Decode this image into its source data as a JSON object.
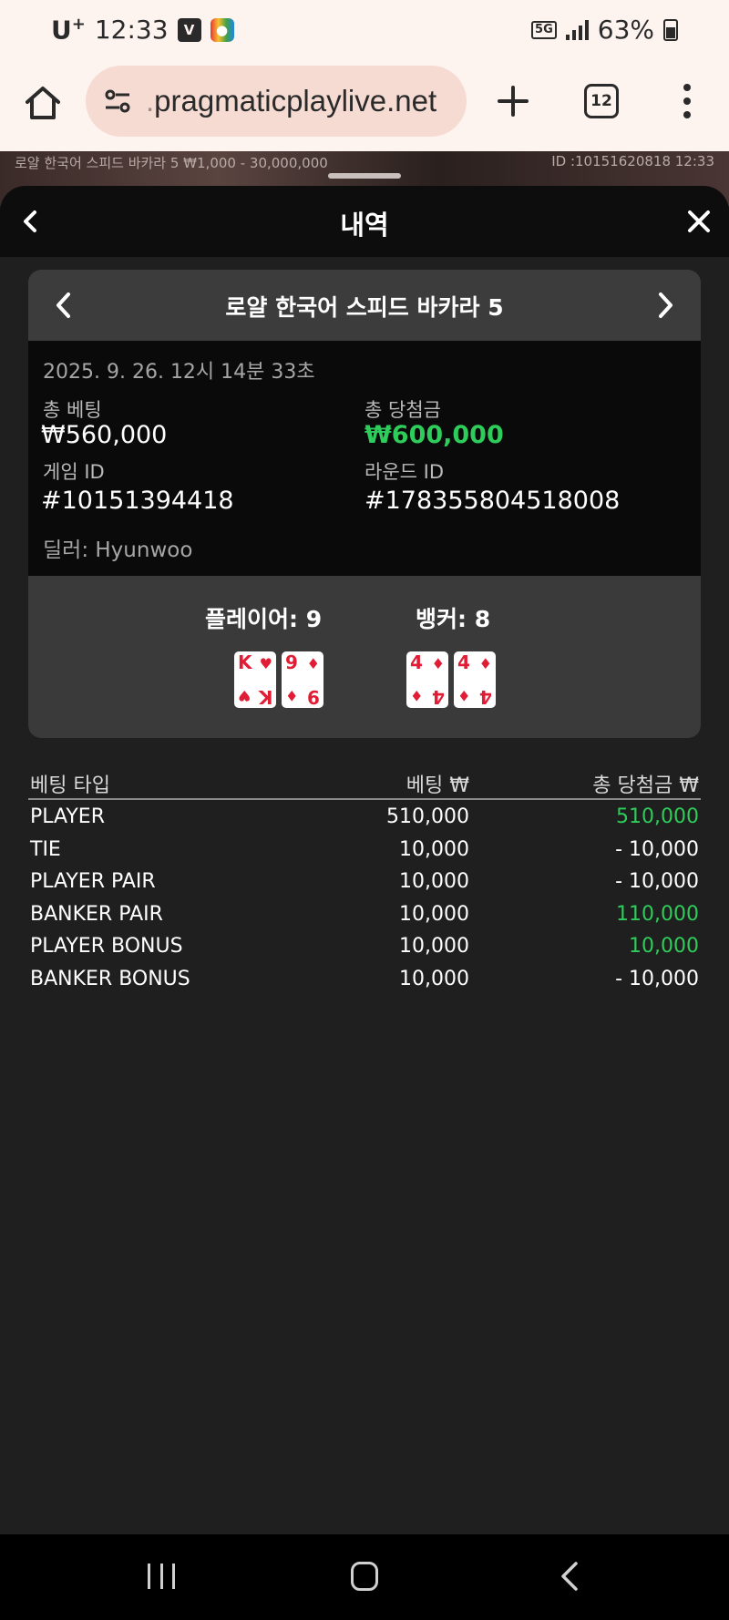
{
  "status_bar": {
    "carrier": "U",
    "carrier_sup": "+",
    "time": "12:33",
    "icon_v": "V",
    "icon_map": "map-icon",
    "network": "5G",
    "battery": "63%"
  },
  "browser": {
    "url_prefix": ".",
    "url": "pragmaticplaylive.net",
    "tab_count": "12"
  },
  "game_strip": {
    "table_info": "로얄 한국어 스피드 바카라 5 ₩1,000 - 30,000,000",
    "id_info": "ID :10151620818 12:33"
  },
  "sheet": {
    "title": "내역"
  },
  "round": {
    "game_name": "로얄 한국어 스피드 바카라 5",
    "datetime": "2025. 9. 26. 12시 14분 33초",
    "total_bet_label": "총 베팅",
    "total_bet": "₩560,000",
    "total_win_label": "총 당첨금",
    "total_win": "₩600,000",
    "game_id_label": "게임 ID",
    "game_id": "#10151394418",
    "round_id_label": "라운드 ID",
    "round_id": "#178355804518008",
    "dealer": "딜러: Hyunwoo",
    "player_label": "플레이어: 9",
    "banker_label": "뱅커: 8",
    "player_cards": [
      {
        "rank": "K",
        "suit": "♥"
      },
      {
        "rank": "9",
        "suit": "♦"
      }
    ],
    "banker_cards": [
      {
        "rank": "4",
        "suit": "♦"
      },
      {
        "rank": "4",
        "suit": "♦"
      }
    ]
  },
  "bets": {
    "headers": {
      "type": "베팅 타입",
      "bet": "베팅 ₩",
      "win": "총 당첨금 ₩"
    },
    "rows": [
      {
        "type": "PLAYER",
        "bet": "510,000",
        "win": "510,000",
        "positive": true
      },
      {
        "type": "TIE",
        "bet": "10,000",
        "win": "- 10,000",
        "positive": false
      },
      {
        "type": "PLAYER PAIR",
        "bet": "10,000",
        "win": "- 10,000",
        "positive": false
      },
      {
        "type": "BANKER PAIR",
        "bet": "10,000",
        "win": "110,000",
        "positive": true
      },
      {
        "type": "PLAYER BONUS",
        "bet": "10,000",
        "win": "10,000",
        "positive": true
      },
      {
        "type": "BANKER BONUS",
        "bet": "10,000",
        "win": "- 10,000",
        "positive": false
      }
    ]
  },
  "colors": {
    "win_green": "#2ecc5a",
    "card_red": "#e11d36"
  }
}
